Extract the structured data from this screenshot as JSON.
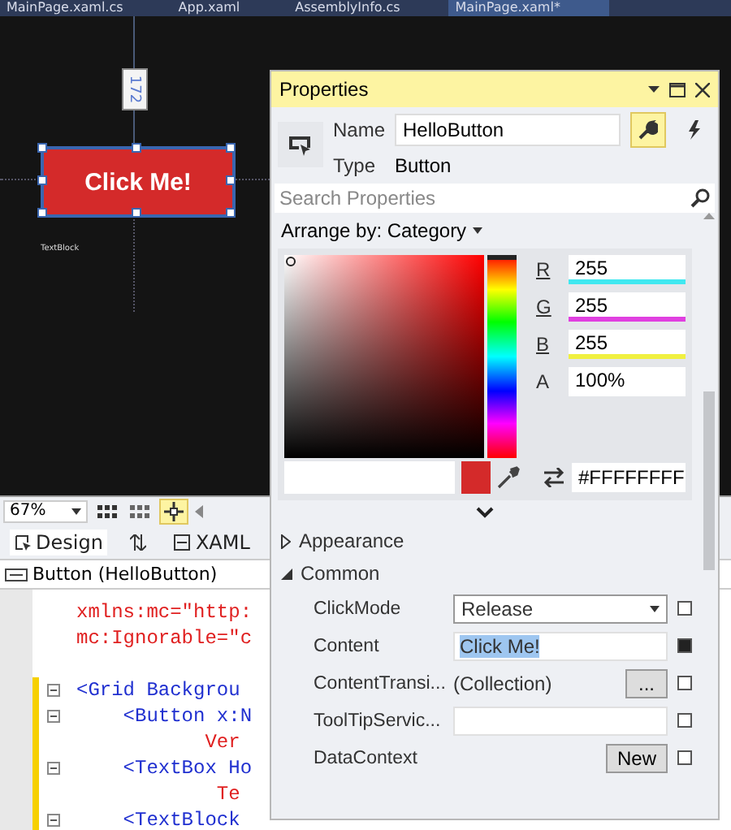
{
  "document_tabs": [
    {
      "label": "MainPage.xaml.cs",
      "selected": false
    },
    {
      "label": "App.xaml",
      "selected": false
    },
    {
      "label": "AssemblyInfo.cs",
      "selected": false
    },
    {
      "label": "MainPage.xaml*",
      "selected": true
    }
  ],
  "designer": {
    "dimension": "172",
    "button_label": "Click Me!",
    "textblock_label": "TextBlock"
  },
  "toolbar": {
    "zoom": "67%"
  },
  "view_tabs": [
    {
      "label": "Design",
      "selected": true
    },
    {
      "label": "XAML",
      "selected": false
    }
  ],
  "breadcrumb": "Button (HelloButton)",
  "code_lines": [
    {
      "kind": "attr",
      "text": "xmlns:mc=\"http:",
      "fold": false,
      "changed": false
    },
    {
      "kind": "attr",
      "text": "mc:Ignorable=\"c",
      "fold": false,
      "changed": false
    },
    {
      "kind": "blank",
      "fold": false,
      "changed": false
    },
    {
      "kind": "tag",
      "text": "<Grid Backgrou",
      "fold": true,
      "changed": true
    },
    {
      "kind": "tag",
      "text": "    <Button x:N",
      "fold": true,
      "changed": true
    },
    {
      "kind": "attr",
      "text": "           Ver",
      "fold": false,
      "changed": true
    },
    {
      "kind": "tag",
      "text": "    <TextBox Ho",
      "fold": true,
      "changed": true
    },
    {
      "kind": "attr",
      "text": "            Te",
      "fold": false,
      "changed": true
    },
    {
      "kind": "tag",
      "text": "    <TextBlock",
      "fold": true,
      "changed": true
    }
  ],
  "properties": {
    "title": "Properties",
    "name_label": "Name",
    "name_value": "HelloButton",
    "type_label": "Type",
    "type_value": "Button",
    "tabs": [
      {
        "kind": "properties",
        "selected": true
      },
      {
        "kind": "events",
        "selected": false
      }
    ],
    "search": {
      "placeholder": "Search Properties"
    },
    "arrange_by": "Arrange by: Category",
    "color": {
      "channels": [
        {
          "label": "R",
          "value": "255",
          "color": "#40e8f0"
        },
        {
          "label": "G",
          "value": "255",
          "color": "#e040e0"
        },
        {
          "label": "B",
          "value": "255",
          "color": "#f0f040"
        },
        {
          "label": "A",
          "value": "100%"
        }
      ],
      "hue": {
        "level": 0
      },
      "hex": "#FFFFFFFF"
    },
    "categories": [
      {
        "label": "Appearance",
        "expanded": false
      },
      {
        "label": "Common",
        "expanded": true,
        "rows": [
          {
            "name": "ClickMode",
            "kind": "dropdown",
            "value": "Release",
            "set": false
          },
          {
            "name": "Content",
            "kind": "text",
            "value": "Click Me!",
            "highlighted": true,
            "set": true
          },
          {
            "name": "ContentTransi...",
            "kind": "collection",
            "value": "(Collection)",
            "button": "...",
            "set": false
          },
          {
            "name": "ToolTipServic...",
            "kind": "text",
            "set": false
          },
          {
            "name": "DataContext",
            "kind": "button",
            "button": "New",
            "set": false
          }
        ]
      }
    ]
  }
}
